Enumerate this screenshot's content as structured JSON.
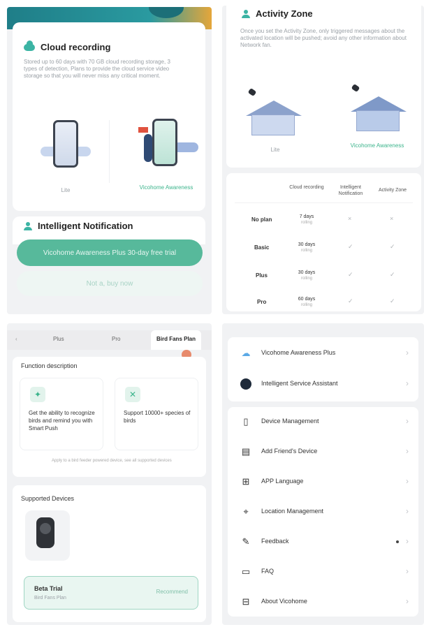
{
  "panel1": {
    "cloud_title": "Cloud recording",
    "cloud_desc": "Stored up to 60 days with 70 GB cloud recording storage, 3 types of detection, Plans to provide the cloud service video storage so that you will never miss any critical moment.",
    "lite_label": "Lite",
    "awareness_label": "Vicohome Awareness",
    "notification_title": "Intelligent Notification",
    "primary_button": "Vicohome Awareness Plus 30-day free trial",
    "secondary_button": "Not a, buy now"
  },
  "panel2": {
    "activity_title": "Activity Zone",
    "activity_desc": "Once you set the Activity Zone, only triggered messages about the activated location will be pushed; avoid any other information about Network fan.",
    "lite_label": "Lite",
    "awareness_label": "Vicohome Awareness",
    "table": {
      "headers": [
        "Cloud recording",
        "Intelligent Notification",
        "Activity Zone"
      ],
      "rows": [
        {
          "label": "No plan",
          "cloud": "7 days",
          "cloud_sub": "rolling",
          "notif": "×",
          "zone": "×"
        },
        {
          "label": "Basic",
          "cloud": "30 days",
          "cloud_sub": "rolling",
          "notif": "✓",
          "zone": "✓"
        },
        {
          "label": "Plus",
          "cloud": "30 days",
          "cloud_sub": "rolling",
          "notif": "✓",
          "zone": "✓"
        },
        {
          "label": "Pro",
          "cloud": "60 days",
          "cloud_sub": "rolling",
          "notif": "✓",
          "zone": "✓"
        }
      ]
    }
  },
  "panel3": {
    "tabs": [
      "Plus",
      "Pro",
      "Bird Fans Plan"
    ],
    "function_title": "Function description",
    "feature1": "Get the ability to recognize birds and remind you with Smart Push",
    "feature2": "Support 10000+ species of birds",
    "footnote": "Apply to a bird feeder powered device, see all supported devices",
    "supported_title": "Supported Devices",
    "trial_title": "Beta Trial",
    "trial_sub": "Bird Fans Plan",
    "trial_action": "Recommend"
  },
  "panel4": {
    "menu1": [
      {
        "icon": "cloud-icon",
        "label": "Vicohome Awareness Plus"
      },
      {
        "icon": "assistant-icon",
        "label": "Intelligent Service Assistant"
      }
    ],
    "menu2": [
      {
        "icon": "device-icon",
        "label": "Device Management"
      },
      {
        "icon": "friend-device-icon",
        "label": "Add Friend's Device"
      },
      {
        "icon": "language-icon",
        "label": "APP Language"
      },
      {
        "icon": "location-icon",
        "label": "Location Management"
      },
      {
        "icon": "feedback-icon",
        "label": "Feedback"
      },
      {
        "icon": "faq-icon",
        "label": "FAQ"
      },
      {
        "icon": "about-icon",
        "label": "About Vicohome"
      }
    ]
  },
  "colors": {
    "accent_green": "#57b99b",
    "brand_teal": "#1f7e88",
    "panel_bg": "#f1f2f4"
  }
}
